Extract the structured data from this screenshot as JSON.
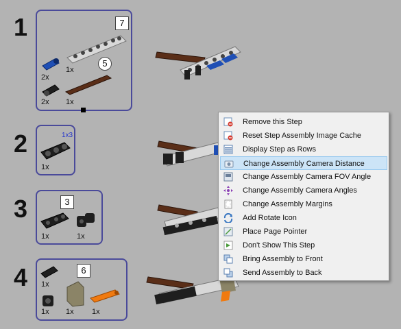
{
  "steps": [
    {
      "number": "1",
      "callouts": [
        "7",
        "5"
      ],
      "quantities": [
        "1x",
        "2x",
        "2x",
        "1x"
      ]
    },
    {
      "number": "2",
      "part_label": "1x3",
      "quantities": [
        "1x"
      ]
    },
    {
      "number": "3",
      "callouts": [
        "3"
      ],
      "quantities": [
        "1x",
        "1x"
      ]
    },
    {
      "number": "4",
      "callouts": [
        "6"
      ],
      "quantities": [
        "1x",
        "1x",
        "1x",
        "1x"
      ]
    }
  ],
  "context_menu": {
    "items": [
      {
        "label": "Remove this Step",
        "icon": "remove-step-icon",
        "highlighted": false
      },
      {
        "label": "Reset Step Assembly Image Cache",
        "icon": "reset-cache-icon",
        "highlighted": false
      },
      {
        "label": "Display Step as Rows",
        "icon": "rows-icon",
        "highlighted": false
      },
      {
        "label": "Change Assembly Camera Distance",
        "icon": "camera-icon",
        "highlighted": true
      },
      {
        "label": "Change Assembly Camera FOV Angle",
        "icon": "fov-icon",
        "highlighted": false
      },
      {
        "label": "Change Assembly Camera Angles",
        "icon": "camera-angles-icon",
        "highlighted": false
      },
      {
        "label": "Change Assembly Margins",
        "icon": "margins-icon",
        "highlighted": false
      },
      {
        "label": "Add Rotate Icon",
        "icon": "rotate-icon",
        "highlighted": false
      },
      {
        "label": "Place Page Pointer",
        "icon": "pointer-icon",
        "highlighted": false
      },
      {
        "label": "Don't Show This Step",
        "icon": "hide-step-icon",
        "highlighted": false
      },
      {
        "label": "Bring Assembly to Front",
        "icon": "bring-front-icon",
        "highlighted": false
      },
      {
        "label": "Send Assembly to Back",
        "icon": "send-back-icon",
        "highlighted": false
      }
    ]
  },
  "colors": {
    "background": "#b3b3b3",
    "pli_border": "#4a4a9a",
    "menu_highlight": "#cce4f7",
    "part_blue": "#1f4fb5",
    "part_brown": "#5a2e18",
    "part_gray": "#d8d8d8",
    "part_black": "#1e1e1e",
    "part_orange": "#f07a10",
    "part_olive": "#8b8467"
  }
}
